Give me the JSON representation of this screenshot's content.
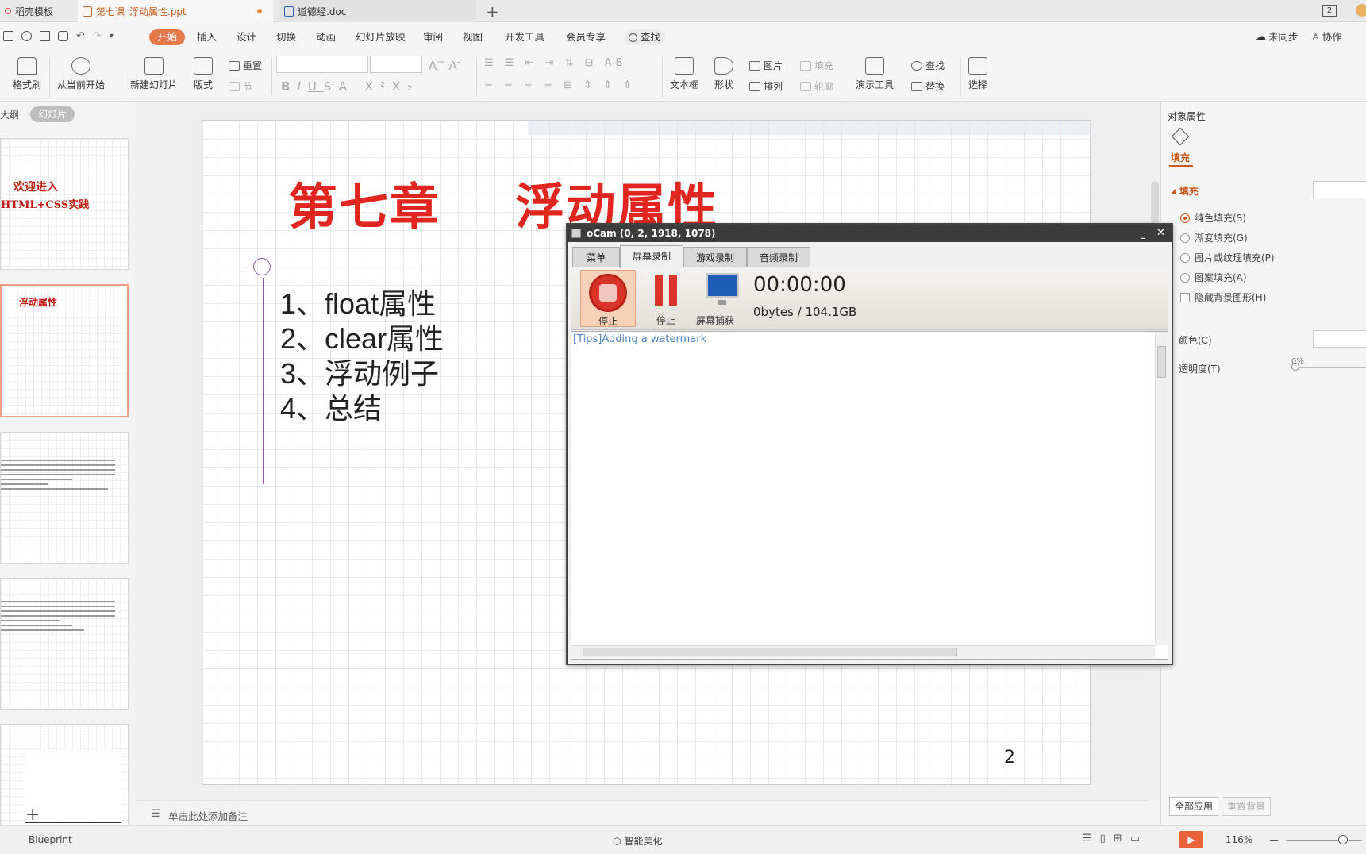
{
  "tabs": [
    {
      "label": "稻壳模板"
    },
    {
      "label": "第七课_浮动属性.ppt"
    },
    {
      "label": "道德经.doc"
    }
  ],
  "titlebar_right": "2",
  "menu": {
    "items": [
      "开始",
      "插入",
      "设计",
      "切换",
      "动画",
      "幻灯片放映",
      "审阅",
      "视图",
      "开发工具",
      "会员专享"
    ],
    "search": "查找",
    "sync": "未同步",
    "collab": "协作"
  },
  "ribbon": {
    "format_painter": "格式刷",
    "play_from_current": "从当前开始",
    "new_slide": "新建幻灯片",
    "layout": "版式",
    "reset": "重置",
    "section": "节",
    "textbox": "文本框",
    "shape": "形状",
    "picture": "图片",
    "arrange": "排列",
    "fill": "填充",
    "outline": "轮廓",
    "presentation_tools": "演示工具",
    "find": "查找",
    "replace": "替换",
    "select": "选择"
  },
  "left": {
    "outline_tab": "大纲",
    "slides_tab": "幻灯片",
    "thumb1_line1": "欢迎进入",
    "thumb1_line2": "HTML+CSS实践",
    "thumb2_title": "浮动属性",
    "add": "+"
  },
  "slide": {
    "title": "第七章    浮动属性",
    "bullets": [
      "1、float属性",
      "2、clear属性",
      "3、浮动例子",
      "4、总结"
    ],
    "page": "2"
  },
  "notes": {
    "placeholder": "单击此处添加备注"
  },
  "right": {
    "header": "对象属性",
    "tab": "填充",
    "section": "填充",
    "options": [
      "纯色填充(S)",
      "渐变填充(G)",
      "图片或纹理填充(P)",
      "图案填充(A)"
    ],
    "hide_bg": "隐藏背景图形(H)",
    "color": "颜色(C)",
    "transparency": "透明度(T)",
    "transparency_value": "0%",
    "apply_all": "全部应用",
    "reset_bg": "重置背景"
  },
  "status": {
    "theme": "Blueprint",
    "beautify": "智能美化",
    "zoom": "116%"
  },
  "ocam": {
    "title": "oCam (0, 2, 1918, 1078)",
    "tabs": [
      "菜单",
      "屏幕录制",
      "游戏录制",
      "音频录制"
    ],
    "record_label": "停止",
    "pause_label": "停止",
    "capture_label": "屏幕捕获",
    "time": "00:00:00",
    "size": "0bytes / 104.1GB",
    "tip": "[Tips]Adding a watermark"
  }
}
